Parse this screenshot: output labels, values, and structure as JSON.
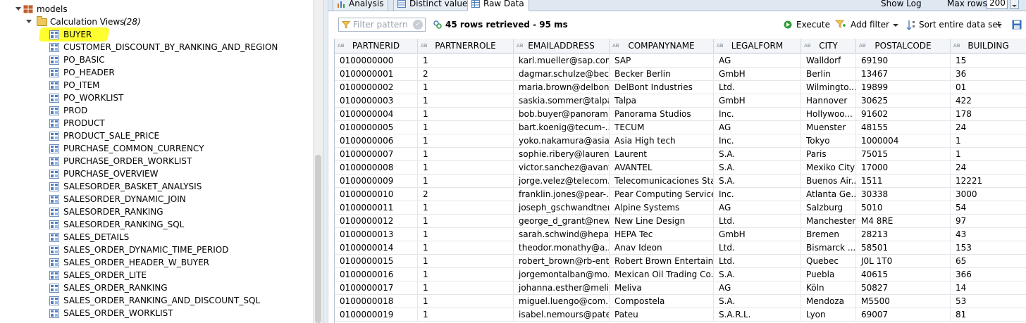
{
  "tree": {
    "items": [
      {
        "label": "models",
        "kind": "package",
        "expanded": true
      },
      {
        "label": "Calculation Views",
        "count": "(28)",
        "kind": "folder",
        "expanded": true
      },
      {
        "label": "BUYER",
        "kind": "view",
        "highlighted": true
      },
      {
        "label": "CUSTOMER_DISCOUNT_BY_RANKING_AND_REGION",
        "kind": "view"
      },
      {
        "label": "PO_BASIC",
        "kind": "view"
      },
      {
        "label": "PO_HEADER",
        "kind": "view"
      },
      {
        "label": "PO_ITEM",
        "kind": "view"
      },
      {
        "label": "PO_WORKLIST",
        "kind": "view"
      },
      {
        "label": "PROD",
        "kind": "view"
      },
      {
        "label": "PRODUCT",
        "kind": "view"
      },
      {
        "label": "PRODUCT_SALE_PRICE",
        "kind": "view"
      },
      {
        "label": "PURCHASE_COMMON_CURRENCY",
        "kind": "view"
      },
      {
        "label": "PURCHASE_ORDER_WORKLIST",
        "kind": "view"
      },
      {
        "label": "PURCHASE_OVERVIEW",
        "kind": "view"
      },
      {
        "label": "SALESORDER_BASKET_ANALYSIS",
        "kind": "view"
      },
      {
        "label": "SALESORDER_DYNAMIC_JOIN",
        "kind": "view"
      },
      {
        "label": "SALESORDER_RANKING",
        "kind": "view"
      },
      {
        "label": "SALESORDER_RANKING_SQL",
        "kind": "view"
      },
      {
        "label": "SALES_DETAILS",
        "kind": "view"
      },
      {
        "label": "SALES_ORDER_DYNAMIC_TIME_PERIOD",
        "kind": "view"
      },
      {
        "label": "SALES_ORDER_HEADER_W_BUYER",
        "kind": "view"
      },
      {
        "label": "SALES_ORDER_LITE",
        "kind": "view"
      },
      {
        "label": "SALES_ORDER_RANKING",
        "kind": "view"
      },
      {
        "label": "SALES_ORDER_RANKING_AND_DISCOUNT_SQL",
        "kind": "view"
      },
      {
        "label": "SALES_ORDER_WORKLIST",
        "kind": "view"
      }
    ]
  },
  "tabs": [
    {
      "label": "Analysis",
      "icon": "chart-icon"
    },
    {
      "label": "Distinct values",
      "icon": "distinct-icon"
    },
    {
      "label": "Raw Data",
      "icon": "table-icon",
      "active": true
    }
  ],
  "tabbar": {
    "show_log": "Show Log",
    "max_rows_label": "Max rows:",
    "max_rows_value": "200"
  },
  "toolbar": {
    "filter_placeholder": "Filter pattern",
    "rows_info": "45 rows retrieved - 95 ms",
    "execute": "Execute",
    "add_filter": "Add filter",
    "sort": "Sort entire data set"
  },
  "grid": {
    "columns": [
      "PARTNERID",
      "PARTNERROLE",
      "EMAILADDRESS",
      "COMPANYNAME",
      "LEGALFORM",
      "CITY",
      "POSTALCODE",
      "BUILDING"
    ],
    "type_tag": "AB",
    "rows": [
      [
        "0100000000",
        "1",
        "karl.mueller@sap.com",
        "SAP",
        "AG",
        "Walldorf",
        "69190",
        "15"
      ],
      [
        "0100000001",
        "2",
        "dagmar.schulze@bec...",
        "Becker Berlin",
        "GmbH",
        "Berlin",
        "13467",
        "36"
      ],
      [
        "0100000002",
        "1",
        "maria.brown@delbon...",
        "DelBont Industries",
        "Ltd.",
        "Wilmingto...",
        "19899",
        "01"
      ],
      [
        "0100000003",
        "1",
        "saskia.sommer@talpa...",
        "Talpa",
        "GmbH",
        "Hannover",
        "30625",
        "422"
      ],
      [
        "0100000004",
        "1",
        "bob.buyer@panoram...",
        "Panorama Studios",
        "Inc.",
        "Hollywoo...",
        "91602",
        "178"
      ],
      [
        "0100000005",
        "1",
        "bart.koenig@tecum-...",
        "TECUM",
        "AG",
        "Muenster",
        "48155",
        "24"
      ],
      [
        "0100000006",
        "1",
        "yoko.nakamura@asia...",
        "Asia High tech",
        "Inc.",
        "Tokyo",
        "1000004",
        "1"
      ],
      [
        "0100000007",
        "1",
        "sophie.ribery@lauren...",
        "Laurent",
        "S.A.",
        "Paris",
        "75015",
        "1"
      ],
      [
        "0100000008",
        "1",
        "victor.sanchez@avant...",
        "AVANTEL",
        "S.A.",
        "Mexiko City",
        "17000",
        "24"
      ],
      [
        "0100000009",
        "1",
        "jorge.velez@telecom...",
        "Telecomunicaciones Star",
        "S.A.",
        "Buenos Air...",
        "1511",
        "12221"
      ],
      [
        "0100000010",
        "2",
        "franklin.jones@pear-...",
        "Pear Computing Services",
        "Inc.",
        "Atlanta Ge...",
        "30338",
        "3000"
      ],
      [
        "0100000011",
        "1",
        "joseph_gschwandtner...",
        "Alpine Systems",
        "AG",
        "Salzburg",
        "5010",
        "54"
      ],
      [
        "0100000012",
        "1",
        "george_d_grant@new...",
        "New Line Design",
        "Ltd.",
        "Manchester",
        "M4 8RE",
        "97"
      ],
      [
        "0100000013",
        "1",
        "sarah.schwind@hepa...",
        "HEPA Tec",
        "GmbH",
        "Bremen",
        "28213",
        "43"
      ],
      [
        "0100000014",
        "1",
        "theodor.monathy@a...",
        "Anav Ideon",
        "Ltd.",
        "Bismarck ...",
        "58501",
        "153"
      ],
      [
        "0100000015",
        "1",
        "robert_brown@rb-ent...",
        "Robert Brown Entertain...",
        "Ltd.",
        "Quebec",
        "J0L 1T0",
        "65"
      ],
      [
        "0100000016",
        "1",
        "jorgemontalban@mo...",
        "Mexican Oil Trading Co...",
        "S.A.",
        "Puebla",
        "40615",
        "366"
      ],
      [
        "0100000017",
        "1",
        "johanna.esther@meli...",
        "Meliva",
        "AG",
        "Köln",
        "50827",
        "14"
      ],
      [
        "0100000018",
        "1",
        "miguel.luengo@com...",
        "Compostela",
        "S.A.",
        "Mendoza",
        "M5500",
        "53"
      ],
      [
        "0100000019",
        "1",
        "isabel.nemours@pate...",
        "Pateu",
        "S.A.R.L.",
        "Lyon",
        "69007",
        "81"
      ]
    ]
  },
  "colors": {
    "highlight": "#ffff30",
    "header_bg": "#f3f5f8",
    "tab_bg": "#dfe7f1",
    "execute_green": "#2e9e3a"
  }
}
